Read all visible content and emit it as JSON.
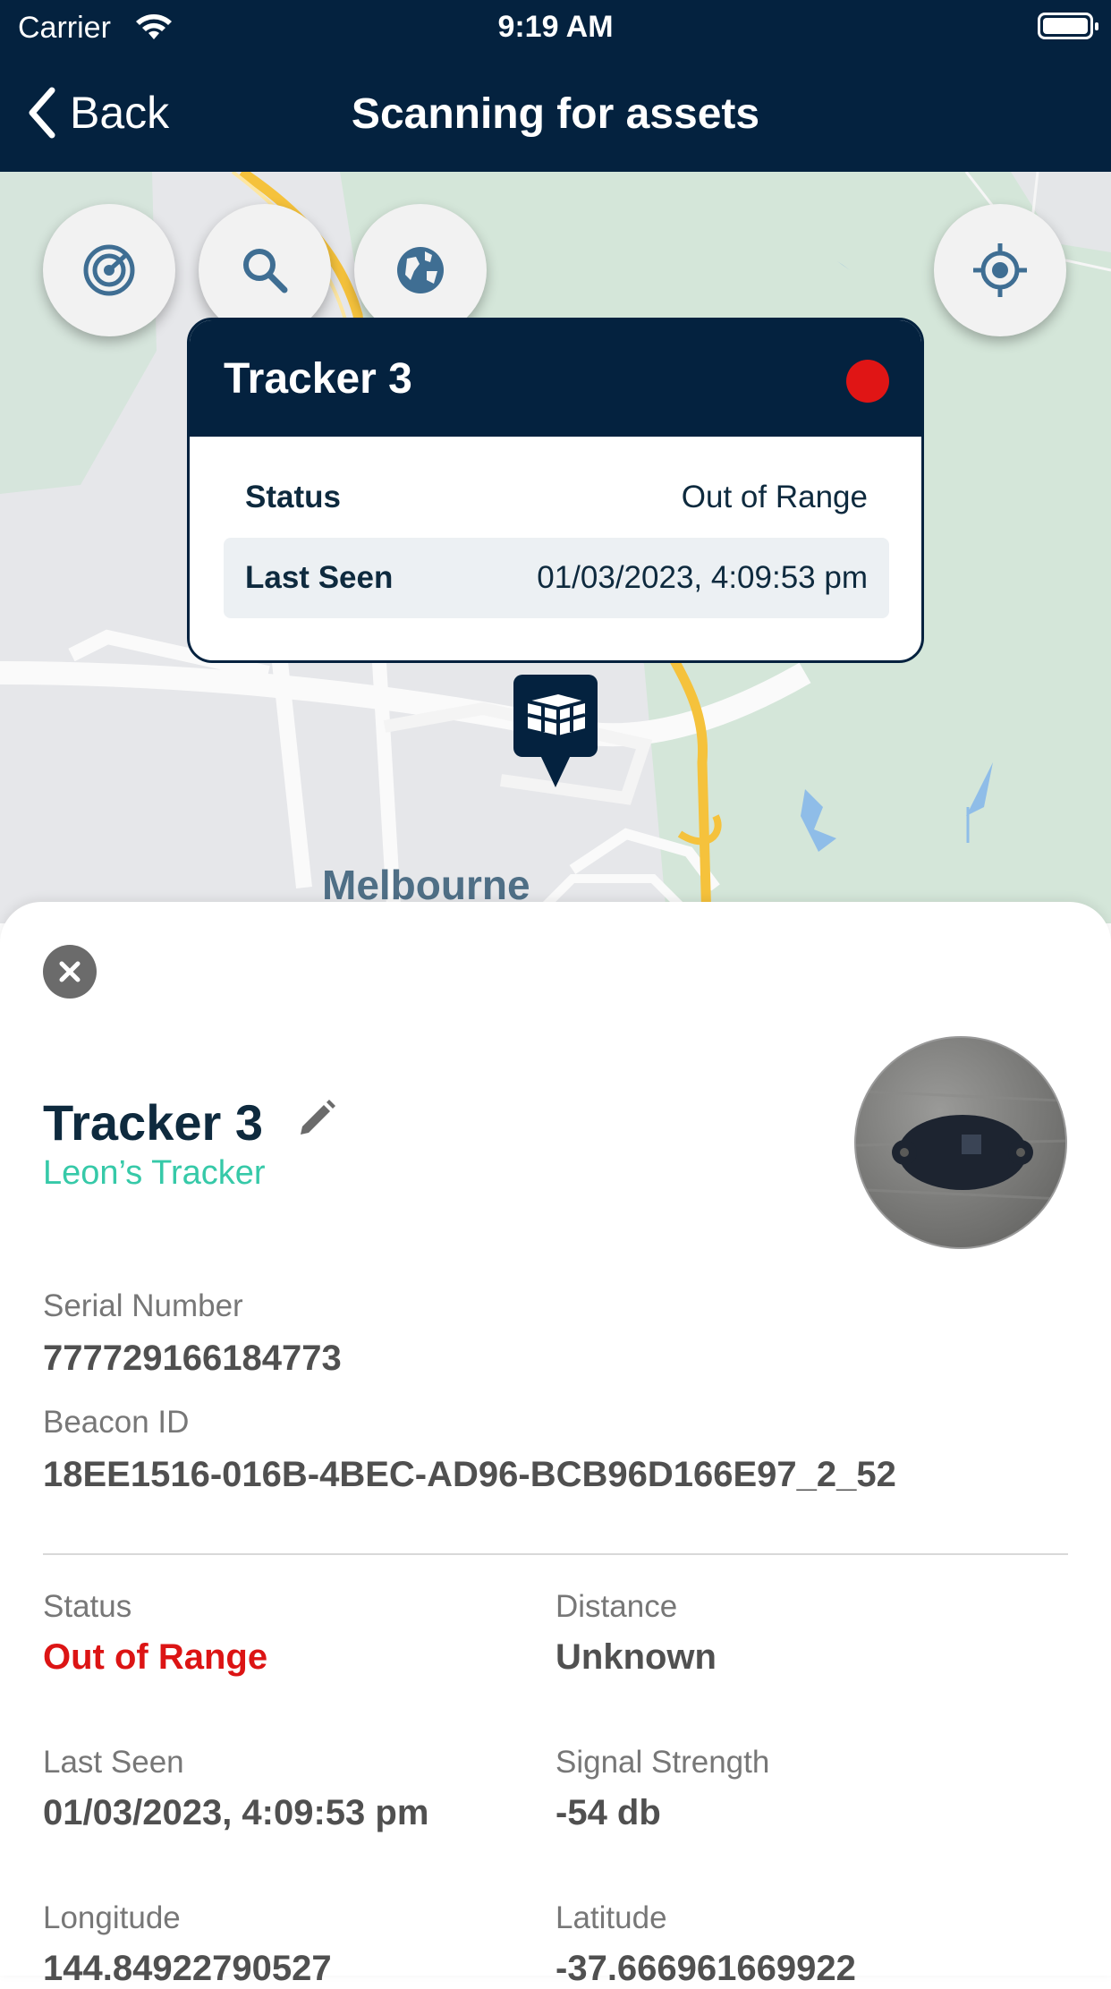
{
  "status_bar": {
    "carrier": "Carrier",
    "time": "9:19 AM"
  },
  "nav": {
    "back_label": "Back",
    "title": "Scanning for assets"
  },
  "map": {
    "place_label": "Melbourne",
    "buttons": [
      "radar-icon",
      "search-icon",
      "globe-icon",
      "locate-icon"
    ],
    "callout": {
      "title": "Tracker 3",
      "status_color": "#e01515",
      "rows": [
        {
          "key": "Status",
          "value": "Out of Range"
        },
        {
          "key": "Last Seen",
          "value": "01/03/2023, 4:09:53 pm"
        }
      ]
    }
  },
  "sheet": {
    "name": "Tracker 3",
    "subtitle": "Leon’s Tracker",
    "serial_label": "Serial Number",
    "serial_value": "777729166184773",
    "beacon_label": "Beacon ID",
    "beacon_value": "18EE1516-016B-4BEC-AD96-BCB96D166E97_2_52",
    "fields": [
      {
        "label": "Status",
        "value": "Out of Range"
      },
      {
        "label": "Distance",
        "value": "Unknown"
      },
      {
        "label": "Last Seen",
        "value": "01/03/2023, 4:09:53 pm"
      },
      {
        "label": "Signal Strength",
        "value": "-54 db"
      },
      {
        "label": "Longitude",
        "value": "144.84922790527"
      },
      {
        "label": "Latitude",
        "value": "-37.666961669922"
      }
    ]
  },
  "colors": {
    "brand_navy": "#04223f",
    "accent_teal": "#36c9a8",
    "status_red": "#dc1414"
  }
}
